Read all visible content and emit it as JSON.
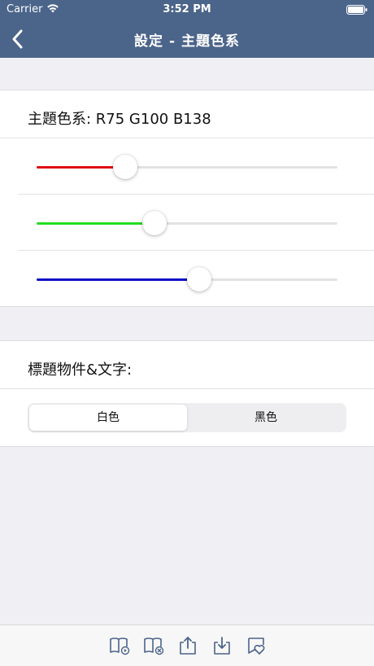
{
  "status_bar": {
    "carrier": "Carrier",
    "time": "3:52 PM"
  },
  "nav": {
    "title": "設定 - 主題色系"
  },
  "theme": {
    "label": "主題色系: R75 G100 B138",
    "sliders": [
      {
        "name": "red",
        "value": 75,
        "max": 255,
        "color": "#e01010"
      },
      {
        "name": "green",
        "value": 100,
        "max": 255,
        "color": "#22dd22"
      },
      {
        "name": "blue",
        "value": 138,
        "max": 255,
        "color": "#1010c8"
      }
    ]
  },
  "title_color": {
    "label": "標題物件&文字:",
    "options": [
      "白色",
      "黑色"
    ],
    "selected": 0
  },
  "toolbar": {
    "icons": [
      "book-play-icon",
      "book-delete-icon",
      "share-upload-icon",
      "download-icon",
      "heart-bookmark-icon"
    ]
  },
  "colors": {
    "nav_bg": "#4b648a",
    "accent": "#4b648a"
  }
}
